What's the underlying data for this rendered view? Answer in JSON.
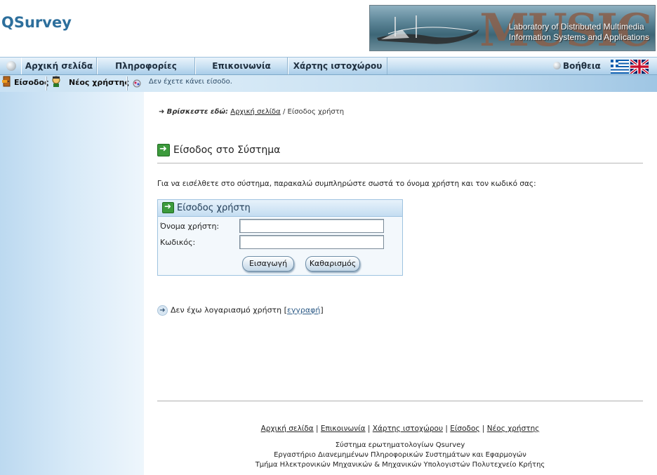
{
  "header": {
    "logo": "QSurvey",
    "banner": {
      "line1": "Laboratory of Distributed Multimedia",
      "line2": "Information Systems and Applications",
      "watermark": "MUSIC"
    }
  },
  "nav": {
    "items": [
      "Αρχική σελίδα",
      "Πληροφορίες",
      "Επικοινωνία",
      "Χάρτης ιστοχώρου"
    ],
    "help": "Βοήθεια",
    "languages": [
      "greek-flag",
      "uk-flag"
    ]
  },
  "subbar": {
    "login": "Είσοδος",
    "new_user": "Νέος χρήστης",
    "status": "Δεν έχετε κάνει είσοδο."
  },
  "breadcrumb": {
    "lead": "Βρίσκεστε εδώ:",
    "home": "Αρχική σελίδα",
    "sep": "/",
    "current": "Είσοδος χρήστη"
  },
  "main": {
    "title": "Είσοδος στο Σύστημα",
    "intro": "Για να εισέλθετε στο σύστημα, παρακαλώ συμπληρώστε σωστά το όνομα χρήστη και τον κωδικό σας:",
    "login_box": {
      "title": "Είσοδος χρήστη",
      "username_label": "Όνομα χρήστη:",
      "username_value": "",
      "password_label": "Κωδικός:",
      "password_value": "",
      "submit": "Εισαγωγή",
      "reset": "Καθαρισμός"
    },
    "no_account": {
      "text": "Δεν έχω λογαριασμό χρήστη",
      "link": "εγγραφή"
    }
  },
  "footer": {
    "links": [
      "Αρχική σελίδα",
      "Επικοινωνία",
      "Χάρτης ιστοχώρου",
      "Είσοδος",
      "Νέος χρήστης"
    ],
    "line1": "Σύστημα ερωτηματολογίων Qsurvey",
    "line2": "Εργαστήριο Διανεμημένων Πληροφορικών Συστημάτων και Εφαρμογών",
    "line3": "Τμήμα Ηλεκτρονικών Μηχανικών & Μηχανικών Υπολογιστών Πολυτεχνείο Κρήτης"
  },
  "colors": {
    "brand": "#2d6f9c",
    "nav_bg": "#c8e0f2",
    "sidebar_bg": "#d8eaf8",
    "accent_green": "#3c9a3c"
  }
}
